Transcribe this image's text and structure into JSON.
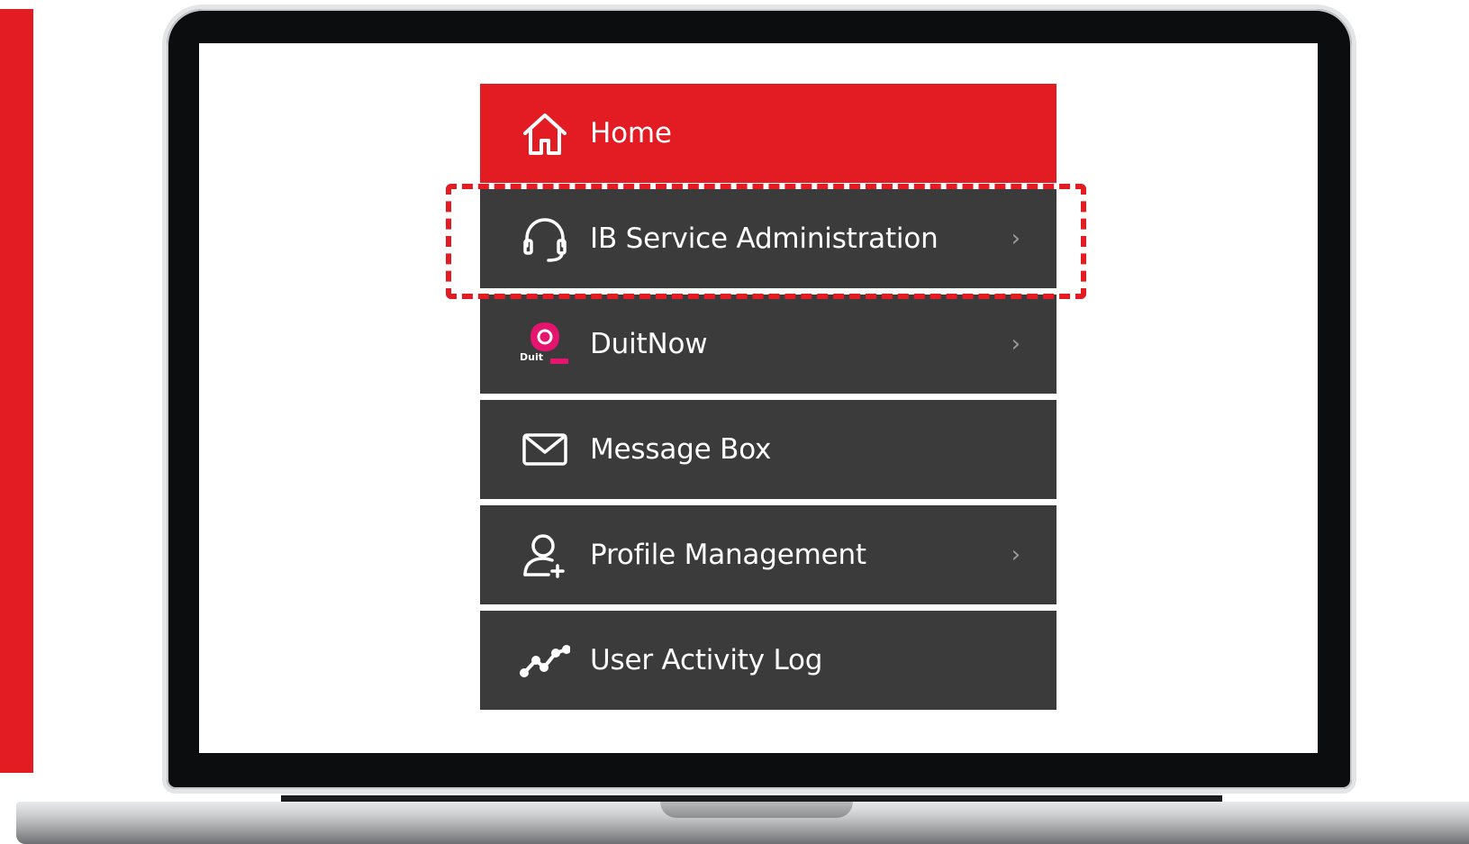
{
  "menu": {
    "items": [
      {
        "label": "Home",
        "icon": "home-icon",
        "active": true,
        "has_submenu": false
      },
      {
        "label": "IB Service Administration",
        "icon": "headset-icon",
        "active": false,
        "has_submenu": true
      },
      {
        "label": "DuitNow",
        "icon": "duitnow-logo-icon",
        "active": false,
        "has_submenu": true
      },
      {
        "label": "Message Box",
        "icon": "envelope-icon",
        "active": false,
        "has_submenu": false
      },
      {
        "label": "Profile Management",
        "icon": "user-add-icon",
        "active": false,
        "has_submenu": true
      },
      {
        "label": "User Activity Log",
        "icon": "trend-line-icon",
        "active": false,
        "has_submenu": false
      }
    ],
    "chevron": "›",
    "duitnow_logo_text": "Duit"
  },
  "colors": {
    "accent": "#e31b23",
    "menu_bg": "#3b3b3c",
    "duitnow_pink": "#e5146f"
  }
}
